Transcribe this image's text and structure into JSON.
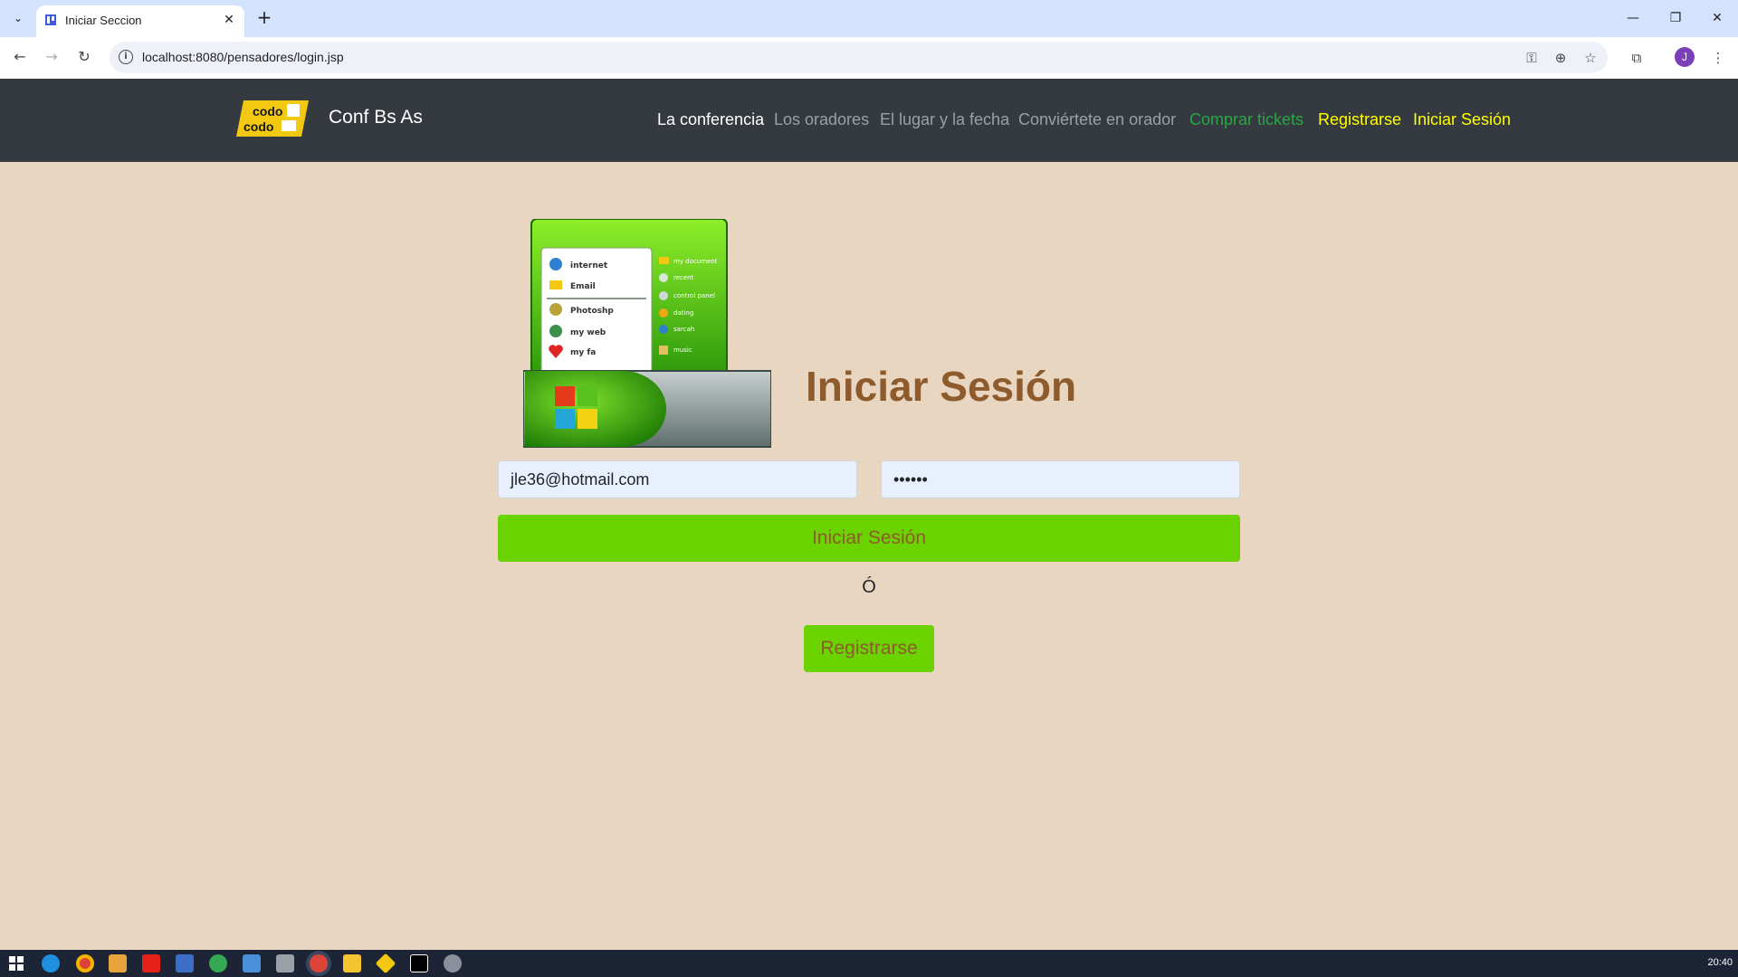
{
  "browser": {
    "tab_title": "Iniciar Seccion",
    "url": "localhost:8080/pensadores/login.jsp",
    "profile_initial": "J"
  },
  "site": {
    "logo_text_top": "codo",
    "logo_text_bottom": "codo",
    "brand": "Conf Bs As",
    "nav": [
      {
        "label": "La conferencia",
        "color": "#ffffff"
      },
      {
        "label": "Los oradores",
        "color": "#9aa0a6"
      },
      {
        "label": "El lugar y la fecha",
        "color": "#9aa0a6"
      },
      {
        "label": "Conviértete en orador",
        "color": "#9aa0a6"
      },
      {
        "label": "Comprar tickets",
        "color": "#28a745"
      },
      {
        "label": "Registrarse",
        "color": "#ffff00"
      },
      {
        "label": "Iniciar Sesión",
        "color": "#ffff00"
      }
    ]
  },
  "hero_menu": {
    "left_items": [
      "internet",
      "Email",
      "Photoshp",
      "my web",
      "my fa"
    ],
    "right_items": [
      "my document",
      "recent",
      "control panel",
      "dating",
      "sarcah",
      "music"
    ]
  },
  "login": {
    "title": "Iniciar Sesión",
    "email_value": "jle36@hotmail.com",
    "password_value": "••••••",
    "submit_label": "Iniciar Sesión",
    "or_text": "Ó",
    "register_label": "Registrarse"
  },
  "taskbar": {
    "clock": "20:40"
  },
  "colors": {
    "page_bg": "#e8d6c0",
    "navbar_bg": "#343a40",
    "button_green": "#6bd300",
    "title_brown": "#8d5b2c"
  }
}
